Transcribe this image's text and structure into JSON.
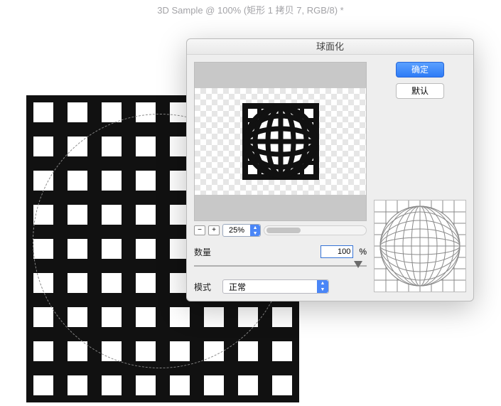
{
  "document": {
    "title": "3D Sample @ 100% (矩形 1 拷贝 7, RGB/8) *"
  },
  "dialog": {
    "title": "球面化",
    "buttons": {
      "ok": "确定",
      "defaults": "默认"
    },
    "zoom": {
      "minus": "−",
      "plus": "+",
      "value": "25%"
    },
    "amount": {
      "label": "数量",
      "value": "100",
      "unit": "%"
    },
    "mode": {
      "label": "模式",
      "value": "正常"
    }
  }
}
